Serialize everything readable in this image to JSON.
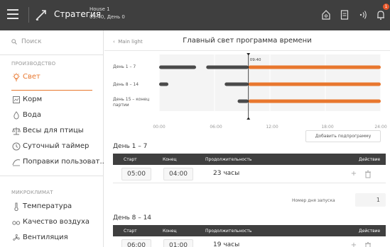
{
  "topbar": {
    "app_title": "Стратегия",
    "house_line1": "House 1",
    "house_line2": "09:40, День 0",
    "alert_count": "1"
  },
  "sidebar": {
    "search_placeholder": "Поиск",
    "sections": [
      {
        "title": "ПРОИЗВОДСТВО",
        "items": [
          {
            "label": "Свет",
            "icon": "bulb-icon",
            "active": true
          },
          {
            "label": "Корм",
            "icon": "feed-icon"
          },
          {
            "label": "Вода",
            "icon": "water-drop-icon"
          },
          {
            "label": "Весы для птицы",
            "icon": "scale-icon"
          },
          {
            "label": "Суточный таймер",
            "icon": "timer-icon"
          },
          {
            "label": "Поправки пользоват...",
            "icon": "curve-icon"
          }
        ]
      },
      {
        "title": "МИКРОКЛИМАТ",
        "items": [
          {
            "label": "Температура",
            "icon": "thermometer-icon"
          },
          {
            "label": "Качество воздуха",
            "icon": "co2-icon"
          },
          {
            "label": "Вентиляция",
            "icon": "fan-icon"
          }
        ]
      }
    ]
  },
  "header": {
    "back_label": "Main light",
    "title": "Главный свет программа времени"
  },
  "chart_data": {
    "type": "gantt",
    "current_time_label": "09:40",
    "current_time_hour": 9.67,
    "x_ticks": [
      "00:00",
      "06:00",
      "12:00",
      "18:00",
      "24:00"
    ],
    "x_range": [
      0,
      24
    ],
    "colors": {
      "inactive": "#4a4a4a",
      "active": "#e8772e",
      "grid": "#f4f4f4",
      "marker": "#222222"
    },
    "rows": [
      {
        "label": "День 1 – 7",
        "segments": [
          {
            "start": 0,
            "end": 4.0,
            "state": "inactive"
          },
          {
            "start": 5.1,
            "end": 9.67,
            "state": "inactive"
          },
          {
            "start": 9.67,
            "end": 24,
            "state": "active"
          }
        ]
      },
      {
        "label": "День 8 – 14",
        "segments": [
          {
            "start": 0,
            "end": 1.0,
            "state": "inactive"
          },
          {
            "start": 7.1,
            "end": 9.67,
            "state": "inactive"
          },
          {
            "start": 9.67,
            "end": 24,
            "state": "active"
          }
        ]
      },
      {
        "label": "День 15 – конец партии",
        "segments": [
          {
            "start": 8.5,
            "end": 9.67,
            "state": "inactive"
          },
          {
            "start": 9.67,
            "end": 24,
            "state": "active"
          }
        ]
      }
    ]
  },
  "add_subprogram_label": "Добавить подпрограмму",
  "table_headers": {
    "start": "Старт",
    "end": "Конец",
    "duration": "Продолжительность",
    "action": "Действие"
  },
  "programs": [
    {
      "title": "День 1 – 7",
      "start": "05:00",
      "end": "04:00",
      "duration": "23 часы"
    },
    {
      "title": "День 8 – 14",
      "start": "06:00",
      "end": "01:00",
      "duration": "19 часы"
    }
  ],
  "launch_day": {
    "label": "Номер дня запуска",
    "value": "1"
  }
}
